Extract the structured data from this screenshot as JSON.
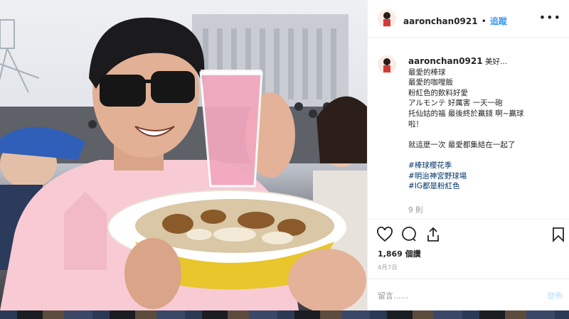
{
  "header": {
    "username": "aaronchan0921",
    "dot": "•",
    "follow_label": "追蹤",
    "more_label": "•••",
    "avatar_icon": "avatar-cartoon-icon"
  },
  "caption": {
    "username": "aaronchan0921",
    "lines": [
      "美好...",
      "最愛的棒球",
      "最愛的咖哩飯",
      "粉紅色的飲料好愛",
      "アルモンテ 好厲害 一天一砲",
      "托仙姑的福 最後終於贏錢 啊~贏球",
      "啦！",
      "",
      "就這麼一次 最愛都集結在一起了",
      "",
      "#棒球櫻花季",
      "#明治神宮野球場",
      "#IG都是粉紅色"
    ]
  },
  "comments_count": "9 則",
  "actions": {
    "like_icon": "heart-icon",
    "comment_icon": "comment-icon",
    "share_icon": "share-icon",
    "save_icon": "bookmark-icon"
  },
  "likes": "1,869 個讚",
  "date": "4月7日",
  "comment_box": {
    "placeholder": "留言......",
    "post_label": "發佈"
  },
  "colors": {
    "link_blue": "#3897f0",
    "hashtag": "#003569",
    "muted": "#999999",
    "post_disabled": "#b2dffc"
  }
}
